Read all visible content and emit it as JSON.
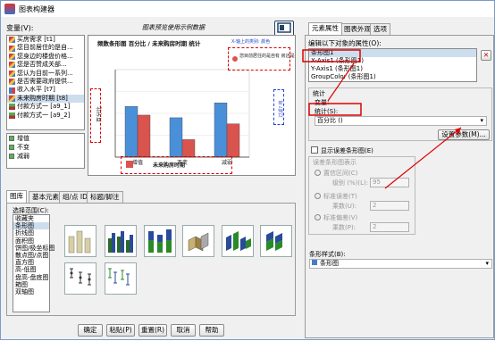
{
  "window": {
    "title": "图表构建器"
  },
  "left": {
    "variables_label": "变量(V):",
    "preview_caption": "图表预览使用示例数据",
    "variables": [
      {
        "label": "买房需求 [t1]",
        "icon": "nominal"
      },
      {
        "label": "您目前居住的是自...",
        "icon": "nominal"
      },
      {
        "label": "您身边的楼盘价格...",
        "icon": "nominal"
      },
      {
        "label": "您是否赞成关部...",
        "icon": "nominal"
      },
      {
        "label": "您认为目前一系列...",
        "icon": "nominal"
      },
      {
        "label": "是否需要政府提供...",
        "icon": "nominal"
      },
      {
        "label": "收入水平 [t7]",
        "icon": "ordinal"
      },
      {
        "label": "未来购房时期 [t8]",
        "icon": "nominal",
        "selected": true
      },
      {
        "label": "付款方式一 [a9_1]",
        "icon": "scale"
      },
      {
        "label": "付款方式一 [a9_2]",
        "icon": "scale"
      }
    ],
    "categories": [
      "增值",
      "不变",
      "减弱"
    ],
    "chart": {
      "title": "频数条形图 百分比 / 未来购房时期 统计",
      "x_drop_label": "未来购房时期",
      "y_drop_label": "百分比",
      "legend_drop_text": "您目前居住的是自有 房还是在租借",
      "legend_drop_title": "X-轴上的类别: 颜色",
      "filter_drop_label": "过滤? 将"
    },
    "chart_data": {
      "type": "bar",
      "categories": [
        "增值",
        "不变",
        "减弱"
      ],
      "series": [
        {
          "values": [
            58,
            45,
            62
          ]
        },
        {
          "values": [
            48,
            20,
            38
          ]
        }
      ],
      "ylim": [
        0,
        100
      ]
    },
    "tabs": [
      "图库",
      "基本元素",
      "组/点 ID",
      "标题/脚注"
    ],
    "gallery_label": "选择范围(C):",
    "gallery_items": [
      "收藏夹",
      "条形图",
      "折线图",
      "面积图",
      "饼图/极坐标图",
      "散点图/点图",
      "直方图",
      "高-低图",
      "盘高-盘底图",
      "箱图",
      "双轴图"
    ],
    "buttons": {
      "ok": "确定",
      "paste": "粘贴(P)",
      "reset": "重置(R)",
      "cancel": "取消",
      "help": "帮助"
    }
  },
  "right": {
    "tabs": [
      "元素属性",
      "图表外观",
      "选项"
    ],
    "edit_props_label": "编辑以下对象的属性(O):",
    "objects": [
      "条形图1",
      "X-Axis1 (条形图1)",
      "Y-Axis1 (条形图1)",
      "GroupColor (条形图1)"
    ],
    "stat_group": "统计",
    "variable_label": "变量:",
    "stat_label": "统计(S):",
    "stat_value": "百分比 ()",
    "set_params_button": "设置参数(M)...",
    "error_bars_check": "显示误差条形图(E)",
    "error_group": "误差条形图表示",
    "ci_label": "置信区间(C)",
    "level_label": "级别 (%)(L):",
    "level_value": "95",
    "se_label": "标准误差(T)",
    "mult1_label": "乘数(U):",
    "mult1_value": "2",
    "sd_label": "标准偏差(V)",
    "mult2_label": "乘数(P):",
    "mult2_value": "2",
    "bar_style_label": "条形样式(B):",
    "bar_style_value": "条形图",
    "bottom_buttons": {
      "apply": "应用(A)",
      "cancel": "取消",
      "help": "帮助"
    }
  },
  "colors": {
    "bar_blue": "#4a90d9",
    "bar_red": "#d9534f",
    "annotation_red": "#dd0000"
  }
}
